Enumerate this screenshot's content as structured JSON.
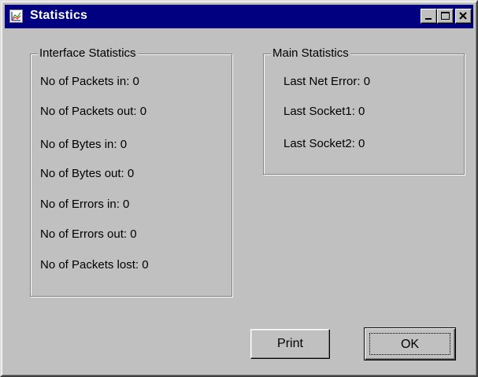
{
  "window": {
    "title": "Statistics"
  },
  "interface_statistics": {
    "legend": "Interface Statistics",
    "items": [
      "No of Packets in: 0",
      "No of Packets out: 0",
      "No of Bytes in: 0",
      "No of Bytes out: 0",
      "No of Errors in: 0",
      "No of Errors out: 0",
      "No of Packets lost: 0"
    ]
  },
  "main_statistics": {
    "legend": "Main Statistics",
    "items": [
      "Last Net Error: 0",
      "Last Socket1: 0",
      "Last Socket2: 0"
    ]
  },
  "buttons": {
    "print_label": "Print",
    "ok_label": "OK"
  },
  "colors": {
    "titlebar": "#000080",
    "face": "#c0c0c0"
  },
  "icons": {
    "app": "chart-icon",
    "minimize": "minimize-icon",
    "maximize": "maximize-icon",
    "close": "close-icon"
  }
}
